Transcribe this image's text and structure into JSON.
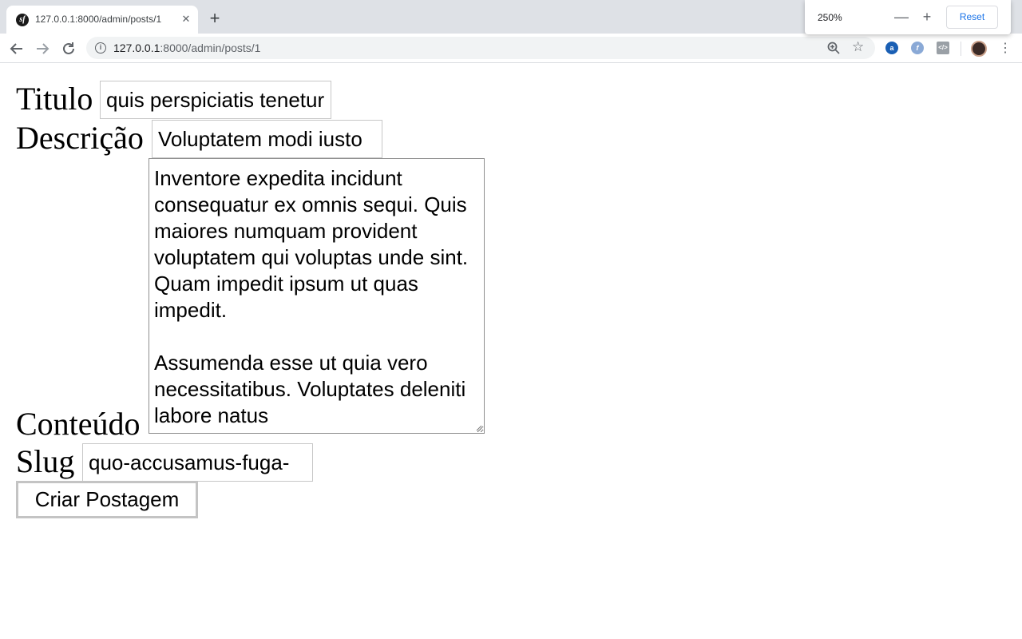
{
  "browser": {
    "tab_title": "127.0.0.1:8000/admin/posts/1",
    "url_host": "127.0.0.1",
    "url_path": ":8000/admin/posts/1",
    "zoom_level": "250%",
    "zoom_reset_label": "Reset",
    "icons": {
      "favicon": "symfony-icon",
      "close": "close-icon",
      "new_tab": "plus-icon",
      "back": "arrow-left-icon",
      "forward": "arrow-right-icon",
      "reload": "reload-icon",
      "site_info": "info-icon",
      "zoom": "zoom-icon",
      "bookmark": "star-icon",
      "menu": "kebab-menu-icon"
    }
  },
  "form": {
    "titulo_label": "Titulo",
    "titulo_value": "quis perspiciatis tenetur",
    "descricao_label": "Descrição",
    "descricao_value": "Voluptatem modi iusto",
    "conteudo_label": "Conteúdo",
    "conteudo_value": "Inventore expedita incidunt consequatur ex omnis sequi. Quis maiores numquam provident voluptatem qui voluptas unde sint. Quam impedit ipsum ut quas impedit.\n\nAssumenda esse ut quia vero necessitatibus. Voluptates deleniti labore natus",
    "slug_label": "Slug",
    "slug_value": "quo-accusamus-fuga-",
    "submit_label": "Criar Postagem"
  }
}
